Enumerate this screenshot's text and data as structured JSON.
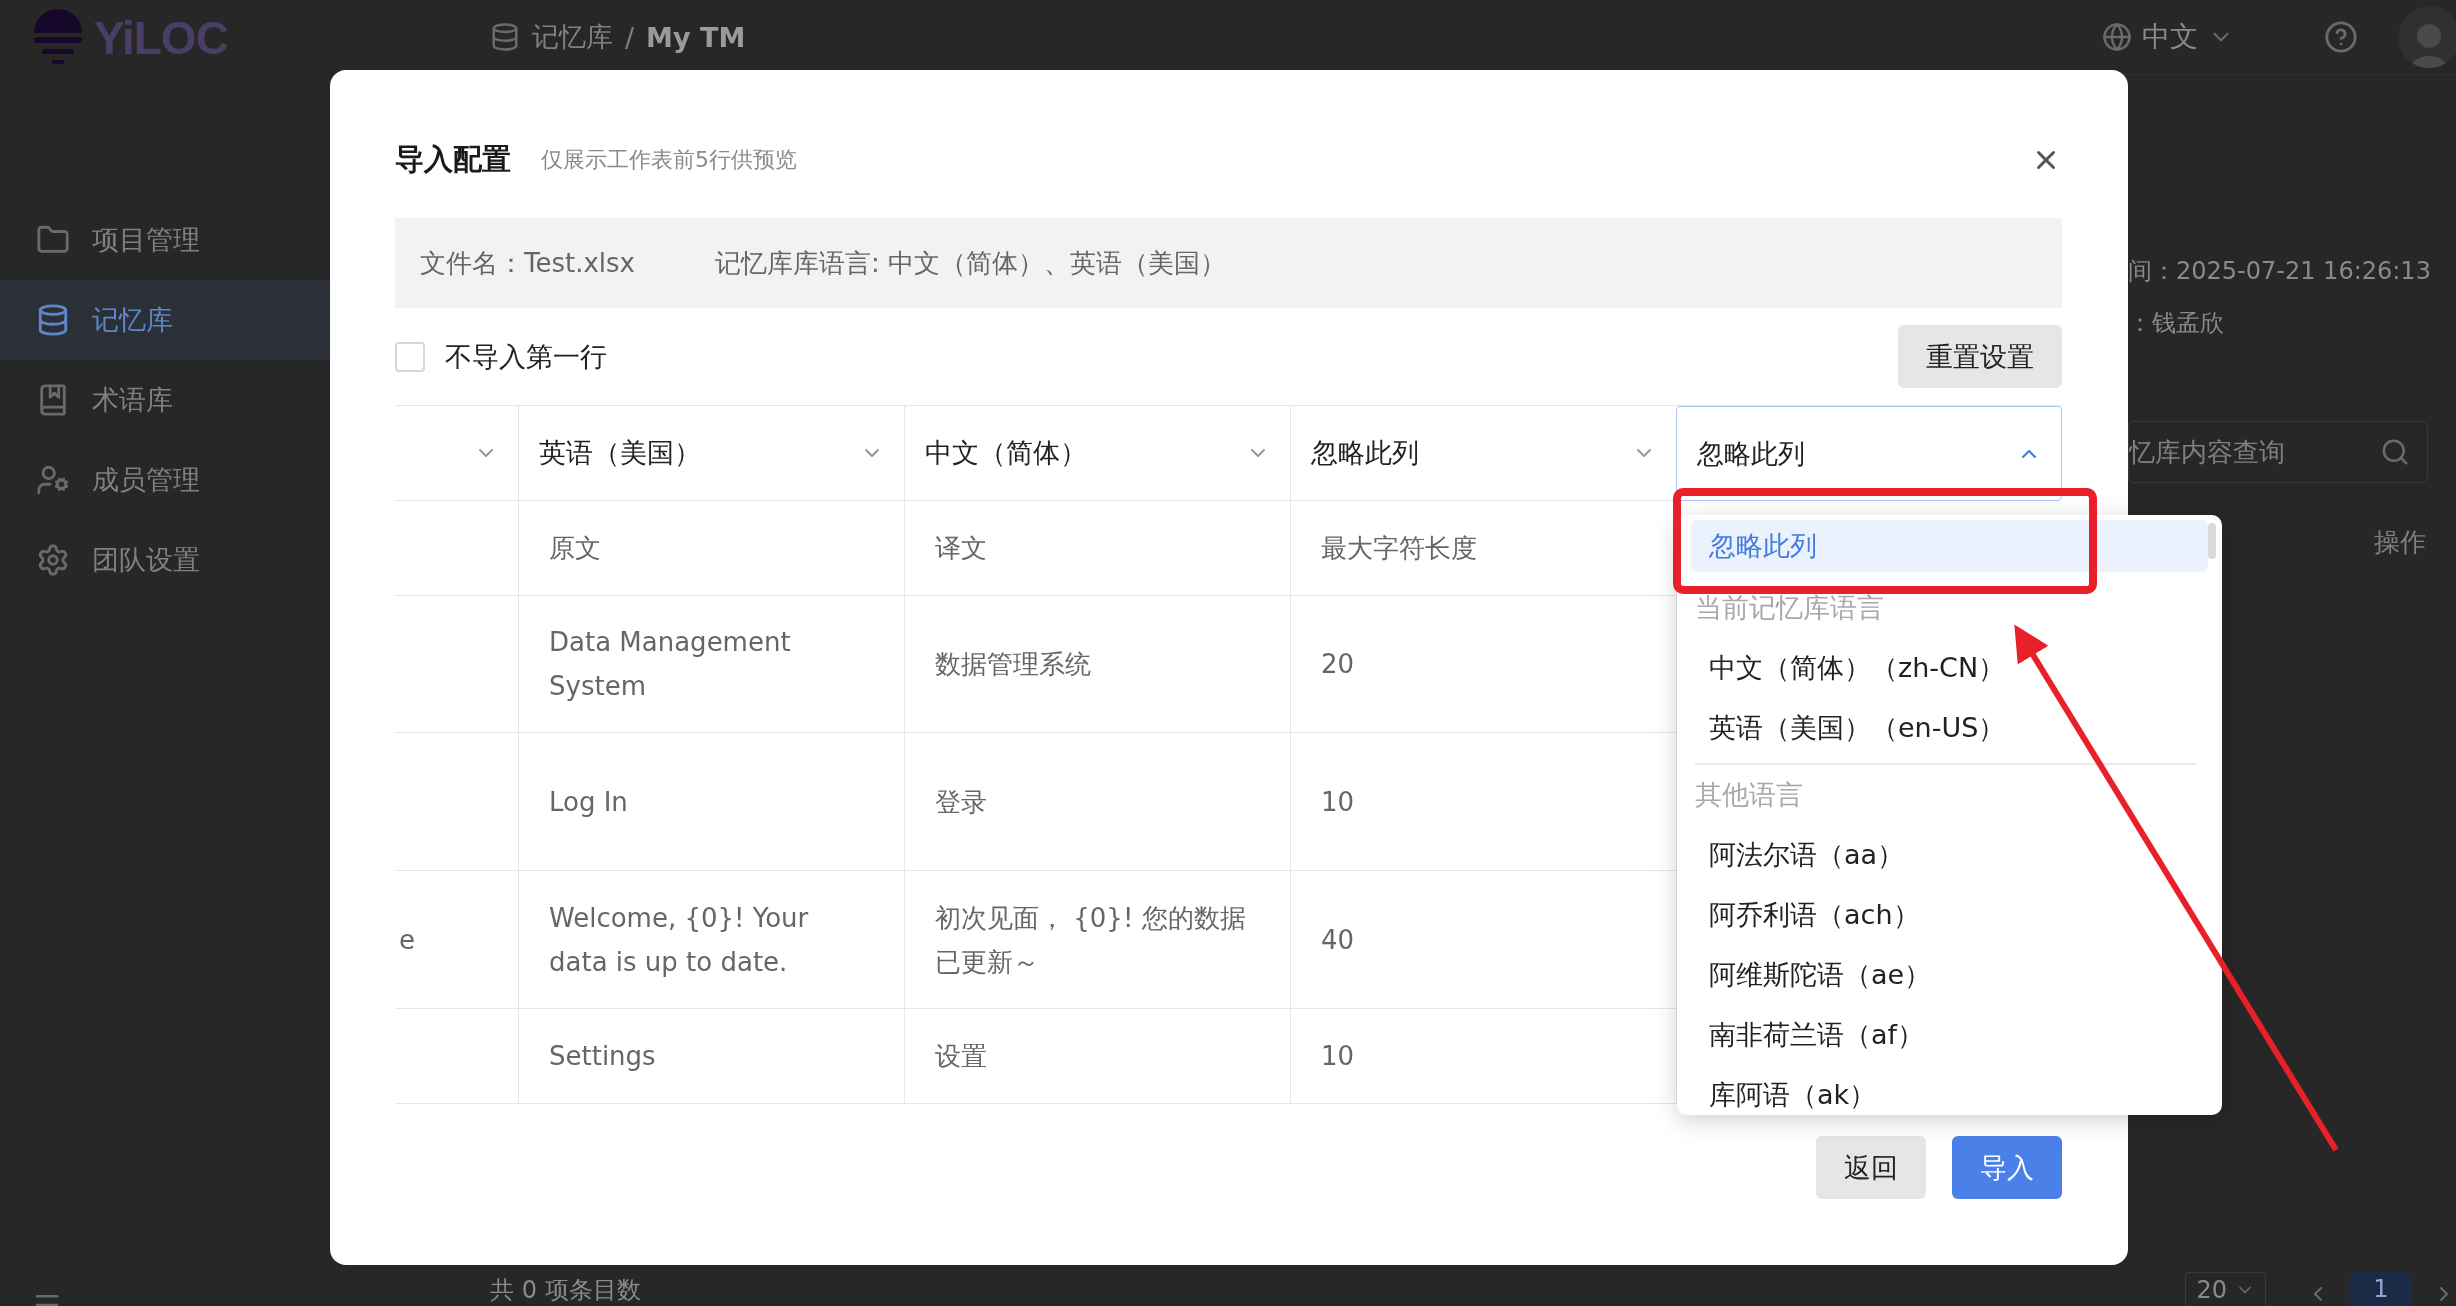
{
  "app": {
    "logo": "YiLOC",
    "breadcrumb": {
      "parent": "记忆库",
      "separator": "/",
      "current": "My TM"
    },
    "language": "中文",
    "sidebar": [
      {
        "label": "项目管理",
        "selected": false
      },
      {
        "label": "记忆库",
        "selected": true
      },
      {
        "label": "术语库",
        "selected": false
      },
      {
        "label": "成员管理",
        "selected": false
      },
      {
        "label": "团队设置",
        "selected": false
      }
    ],
    "detail": {
      "time": "间：2025-07-21 16:26:13",
      "owner": "：钱孟欣",
      "search_placeholder": "忆库内容查询",
      "actions_heading": "操作"
    },
    "footer": {
      "total": "共 0 项条目数",
      "page_size": "20",
      "page": "1"
    }
  },
  "dialog": {
    "title": "导入配置",
    "subtitle": "仅展示工作表前5行供预览",
    "file_info": [
      "文件名：Test.xlsx",
      "记忆库库语言: 中文（简体）、英语（美国）"
    ],
    "skip_first_row": {
      "label": "不导入第一行",
      "checked": false
    },
    "reset_button": "重置设置",
    "columns": [
      {
        "open": false
      },
      {
        "label": "英语（美国）",
        "open": false
      },
      {
        "label": "中文（简体）",
        "open": false
      },
      {
        "label": "忽略此列",
        "open": false
      },
      {
        "label": "忽略此列",
        "open": true
      }
    ],
    "rows": [
      {
        "cells": [
          "",
          "原文",
          "译文",
          "最大字符长度"
        ]
      },
      {
        "cells": [
          "",
          "Data Management System",
          "数据管理系统",
          "20"
        ]
      },
      {
        "cells": [
          "",
          "Log In",
          "登录",
          "10"
        ]
      },
      {
        "cells": [
          "e",
          "Welcome, {0}! Your data is up to date.",
          "初次见面， {0}! 您的数据已更新～",
          "40"
        ]
      },
      {
        "cells": [
          "",
          "Settings",
          "设置",
          "10"
        ]
      }
    ],
    "dropdown": [
      {
        "kind": "option",
        "label": "忽略此列",
        "selected": true
      },
      {
        "kind": "group",
        "label": "当前记忆库语言"
      },
      {
        "kind": "option",
        "label": "中文（简体）（zh-CN）",
        "selected": false
      },
      {
        "kind": "option",
        "label": "英语（美国）（en-US）",
        "selected": false
      },
      {
        "kind": "divider"
      },
      {
        "kind": "group",
        "label": "其他语言"
      },
      {
        "kind": "option",
        "label": "阿法尔语（aa）",
        "selected": false
      },
      {
        "kind": "option",
        "label": "阿乔利语（ach）",
        "selected": false
      },
      {
        "kind": "option",
        "label": "阿维斯陀语（ae）",
        "selected": false
      },
      {
        "kind": "option",
        "label": "南非荷兰语（af）",
        "selected": false
      },
      {
        "kind": "option",
        "label": "库阿语（ak）",
        "selected": false
      }
    ],
    "buttons": [
      {
        "kind": "secondary",
        "label": "返回"
      },
      {
        "kind": "primary",
        "label": "导入"
      }
    ]
  }
}
